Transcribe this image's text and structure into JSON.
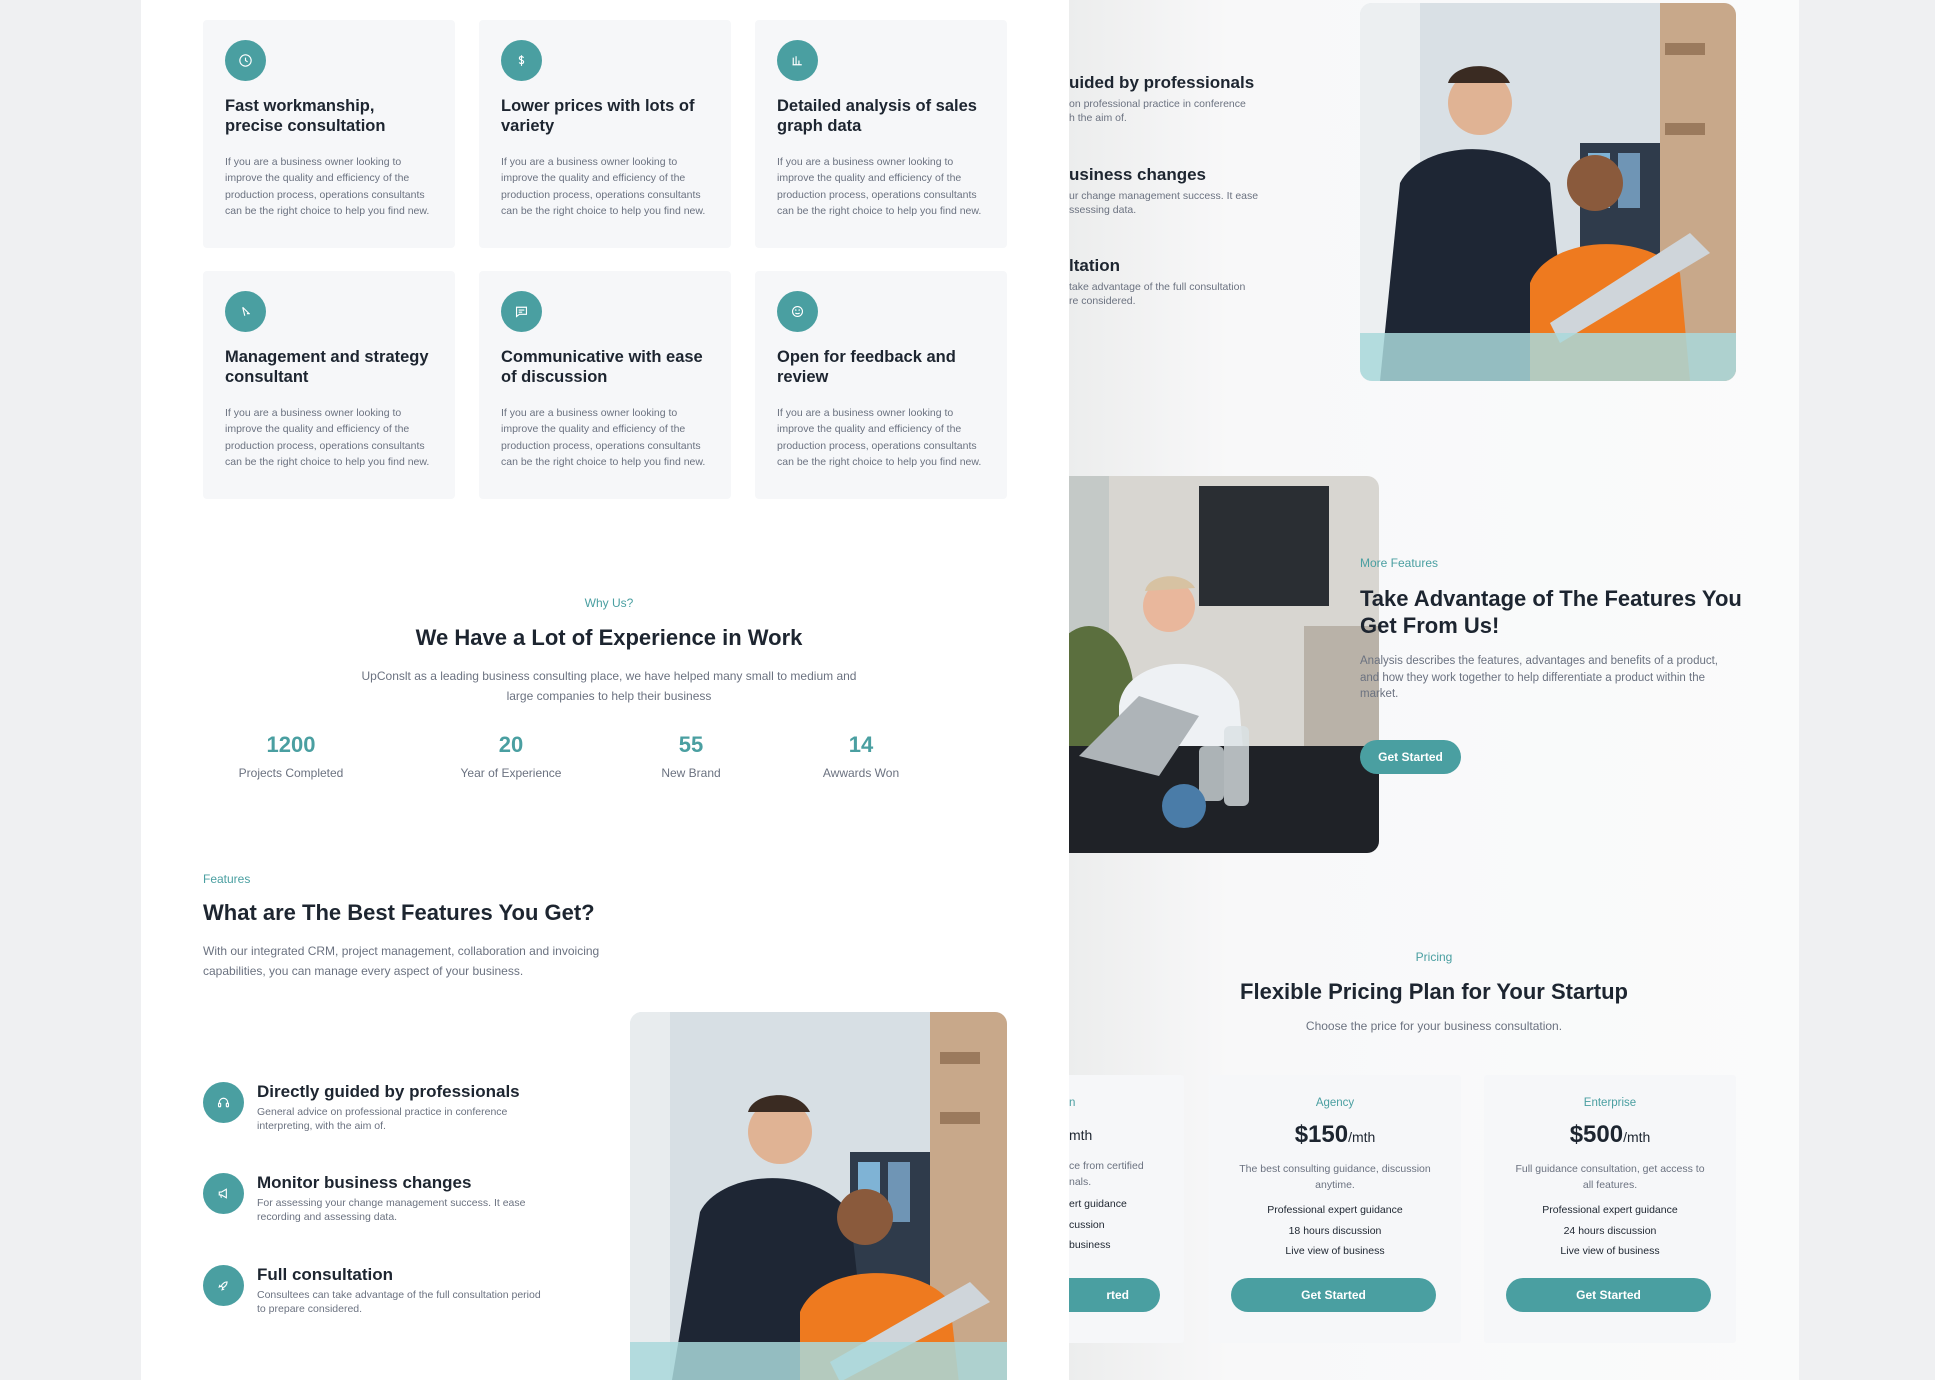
{
  "services": [
    {
      "title": "Fast workmanship, precise consultation",
      "desc": "If you are a business owner looking to improve the quality and efficiency of the production process, operations consultants can be the right choice to help you find new.",
      "icon": "clock-icon"
    },
    {
      "title": "Lower prices with lots of variety",
      "desc": "If you are a business owner looking to improve the quality and efficiency of the production process, operations consultants can be the right choice to help you find new.",
      "icon": "dollar-icon"
    },
    {
      "title": "Detailed analysis of sales graph data",
      "desc": "If you are a business owner looking to improve the quality and efficiency of the production process, operations consultants can be the right choice to help you find new.",
      "icon": "bar-chart-icon"
    },
    {
      "title": "Management and strategy consultant",
      "desc": "If you are a business owner looking to improve the quality and efficiency of the production process, operations consultants can be the right choice to help you find new.",
      "icon": "compass-icon"
    },
    {
      "title": "Communicative with ease of discussion",
      "desc": "If you are a business owner looking to improve the quality and efficiency of the production process, operations consultants can be the right choice to help you find new.",
      "icon": "chat-icon"
    },
    {
      "title": "Open for feedback and review",
      "desc": "If you are a business owner looking to improve the quality and efficiency of the production process, operations consultants can be the right choice to help you find new.",
      "icon": "smile-icon"
    }
  ],
  "why": {
    "eyebrow": "Why Us?",
    "title": "We Have a Lot of Experience in Work",
    "subtitle": "UpConslt as a leading business consulting place, we have helped many small to medium and large companies to help their business",
    "stats": [
      {
        "value": "1200",
        "label": "Projects Completed"
      },
      {
        "value": "20",
        "label": "Year of Experience"
      },
      {
        "value": "55",
        "label": "New Brand"
      },
      {
        "value": "14",
        "label": "Awwards Won"
      }
    ]
  },
  "features": {
    "eyebrow": "Features",
    "title": "What are The Best Features You Get?",
    "subtitle": "With our integrated CRM, project management, collaboration and invoicing capabilities, you can manage every aspect of your business.",
    "items": [
      {
        "title": "Directly guided by professionals",
        "desc": "General advice on professional practice in conference interpreting, with the aim of.",
        "icon": "headset-icon"
      },
      {
        "title": "Monitor business changes",
        "desc": "For assessing your change management success. It ease recording and assessing data.",
        "icon": "megaphone-icon"
      },
      {
        "title": "Full consultation",
        "desc": "Consultees can take advantage of the full consultation period to prepare considered.",
        "icon": "rocket-icon"
      }
    ]
  },
  "right_features_cropped": [
    {
      "title": "uided by professionals",
      "desc_1": "on professional practice in conference",
      "desc_2": "h the aim of."
    },
    {
      "title": "usiness changes",
      "desc_1": "ur change management success. It ease",
      "desc_2": "ssessing data."
    },
    {
      "title": "ltation",
      "desc_1": "take advantage of the full consultation",
      "desc_2": "re considered."
    }
  ],
  "more_features": {
    "eyebrow": "More Features",
    "title": "Take Advantage of The Features You Get From Us!",
    "subtitle": "Analysis describes the features, advantages and benefits of a product, and how they work together to help differentiate a product within the market.",
    "button": "Get Started"
  },
  "pricing": {
    "eyebrow": "Pricing",
    "title": "Flexible Pricing Plan for Your Startup",
    "subtitle": "Choose the price for your business consultation.",
    "cropped_plan": {
      "name": "n",
      "price": "mth",
      "desc_1": "ce from certified",
      "desc_2": "nals.",
      "features": [
        "ert guidance",
        "cussion",
        "business"
      ],
      "button": "rted"
    },
    "plans": [
      {
        "name": "Agency",
        "price": "$150",
        "period": "/mth",
        "desc": "The best consulting guidance, discussion anytime.",
        "features": [
          "Professional expert guidance",
          "18 hours discussion",
          "Live view of business"
        ],
        "button": "Get Started"
      },
      {
        "name": "Enterprise",
        "price": "$500",
        "period": "/mth",
        "desc": "Full guidance consultation, get access to all features.",
        "features": [
          "Professional expert guidance",
          "24 hours discussion",
          "Live view of business"
        ],
        "button": "Get Started"
      }
    ]
  },
  "colors": {
    "accent": "#4a9fa1",
    "card": "#f6f7f9",
    "page": "#eff0f2"
  }
}
